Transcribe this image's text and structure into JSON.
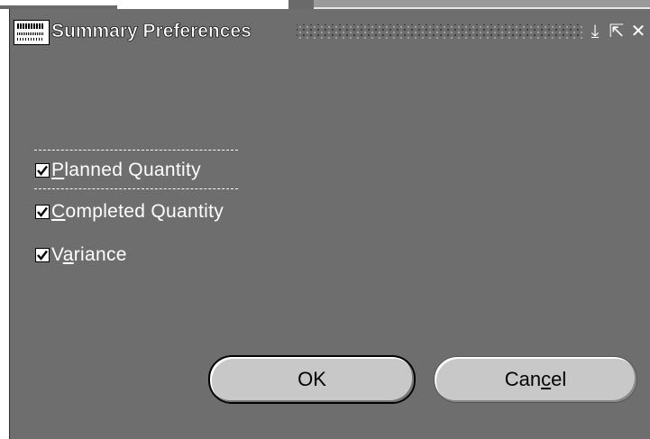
{
  "window": {
    "title": "Summary Preferences",
    "app_icon": "oracle-applications-icon",
    "controls": {
      "minimize_glyph": "⤓",
      "maximize_glyph": "⇱",
      "close_glyph": "✕"
    }
  },
  "options": [
    {
      "label_prefix": "",
      "mnemonic": "P",
      "label_suffix": "lanned Quantity",
      "checked": true
    },
    {
      "label_prefix": "",
      "mnemonic": "C",
      "label_suffix": "ompleted Quantity",
      "checked": true
    },
    {
      "label_prefix": "V",
      "mnemonic": "a",
      "label_suffix": "riance",
      "checked": true
    }
  ],
  "buttons": {
    "ok_label": "OK",
    "cancel_prefix": "Can",
    "cancel_mnemonic": "c",
    "cancel_suffix": "el"
  },
  "colors": {
    "window_background": "#6e6e6e",
    "text": "#ffffff",
    "button_face": "#c8c8c8"
  }
}
